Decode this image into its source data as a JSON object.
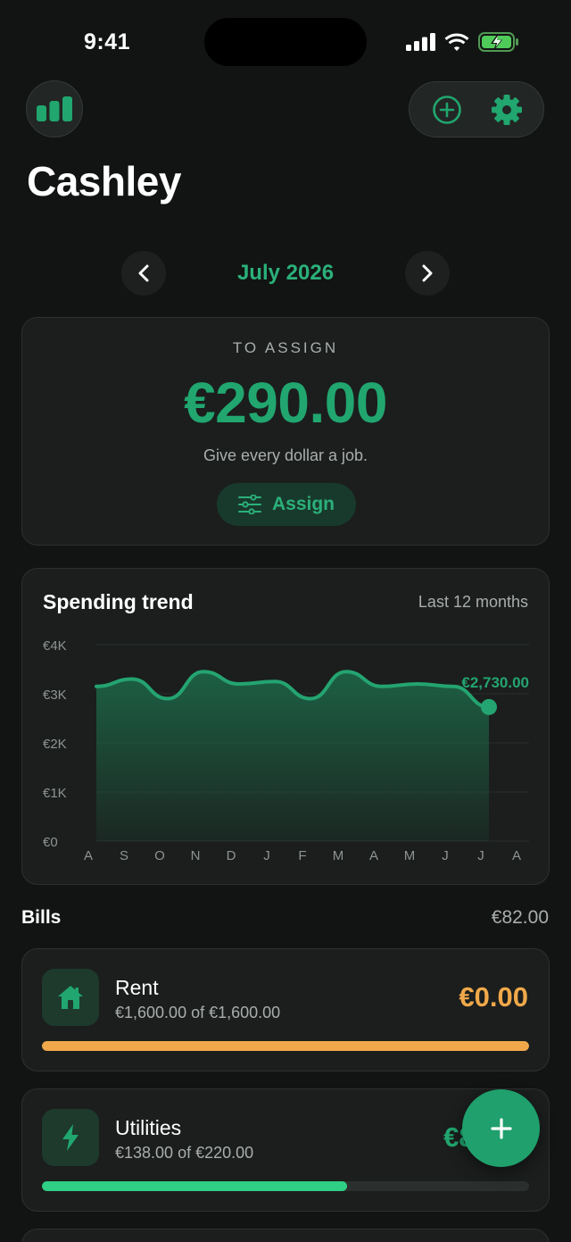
{
  "status": {
    "time": "9:41"
  },
  "header": {
    "app_title": "Cashley",
    "add_icon": "plus-circle-icon",
    "settings_icon": "gear-icon",
    "stats_icon": "bar-chart-icon"
  },
  "month_nav": {
    "label": "July 2026"
  },
  "assign": {
    "label": "TO ASSIGN",
    "amount": "€290.00",
    "subtitle": "Give every dollar a job.",
    "button_label": "Assign"
  },
  "trend": {
    "title": "Spending trend",
    "range": "Last 12 months"
  },
  "chart_data": {
    "type": "area",
    "title": "Spending trend",
    "subtitle": "Last 12 months",
    "categories": [
      "A",
      "S",
      "O",
      "N",
      "D",
      "J",
      "F",
      "M",
      "A",
      "M",
      "J",
      "J",
      "A"
    ],
    "values": [
      3150,
      3300,
      2900,
      3450,
      3200,
      3250,
      2900,
      3450,
      3150,
      3200,
      3150,
      2730
    ],
    "y_ticks": [
      "€0",
      "€1K",
      "€2K",
      "€3K",
      "€4K"
    ],
    "ylim": [
      0,
      4000
    ],
    "last_value_label": "€2,730.00",
    "grid": true,
    "colors": {
      "line": "#24a470",
      "fill": "#1d6b4a"
    }
  },
  "bills": {
    "title": "Bills",
    "total": "€82.00",
    "items": [
      {
        "name": "Rent",
        "sub": "€1,600.00 of €1,600.00",
        "amount": "€0.00",
        "progress": 1.0,
        "color": "#f0a84a",
        "icon": "house-icon"
      },
      {
        "name": "Utilities",
        "sub": "€138.00 of €220.00",
        "amount": "€82.00",
        "progress": 0.627,
        "color": "#2fcf85",
        "icon": "lightning-icon"
      }
    ]
  },
  "fab": {
    "icon": "plus-icon"
  },
  "colors": {
    "accent": "#21a66f",
    "background": "#121413",
    "card": "#1b1e1d"
  }
}
